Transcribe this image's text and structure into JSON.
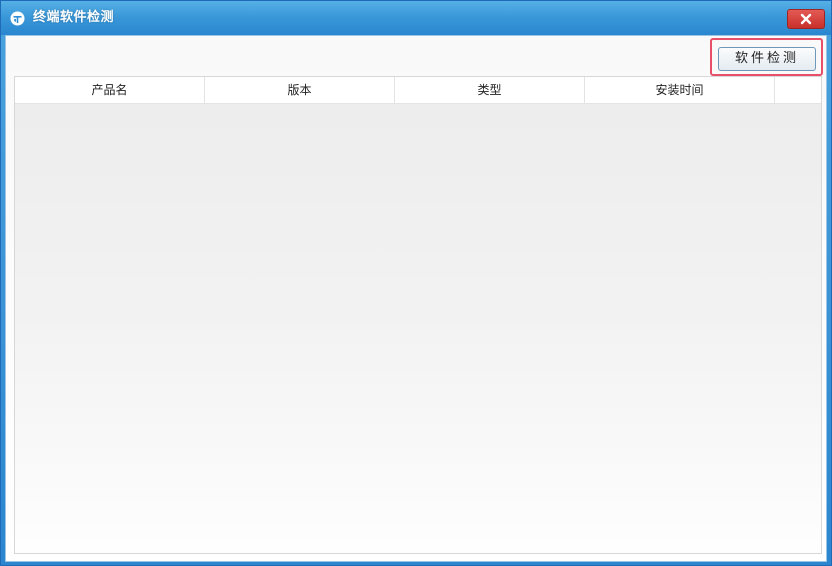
{
  "window": {
    "title": "终端软件检测",
    "colors": {
      "titlebar": "#3896d8",
      "close_button": "#d8413c",
      "highlight_border": "#e8506a"
    }
  },
  "toolbar": {
    "detect_button_label": "软件检测"
  },
  "table": {
    "columns": [
      "产品名",
      "版本",
      "类型",
      "安装时间",
      ""
    ],
    "rows": []
  },
  "icons": {
    "app": "app-logo-icon",
    "close": "close-icon"
  }
}
